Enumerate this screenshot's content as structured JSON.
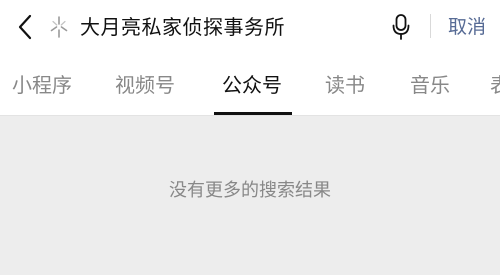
{
  "search": {
    "query": "大月亮私家侦探事务所",
    "cancel_label": "取消"
  },
  "tabs": [
    {
      "label": "小程序"
    },
    {
      "label": "视频号"
    },
    {
      "label": "公众号"
    },
    {
      "label": "读书"
    },
    {
      "label": "音乐"
    },
    {
      "label": "表"
    }
  ],
  "active_tab_index": 2,
  "results": {
    "empty_message": "没有更多的搜索结果"
  },
  "icons": {
    "back": "chevron-left-icon",
    "assistant": "sparkle-icon",
    "voice": "microphone-icon"
  },
  "colors": {
    "link": "#576b95",
    "active_tab": "#111111",
    "inactive_tab": "#888888",
    "background": "#ededed"
  }
}
